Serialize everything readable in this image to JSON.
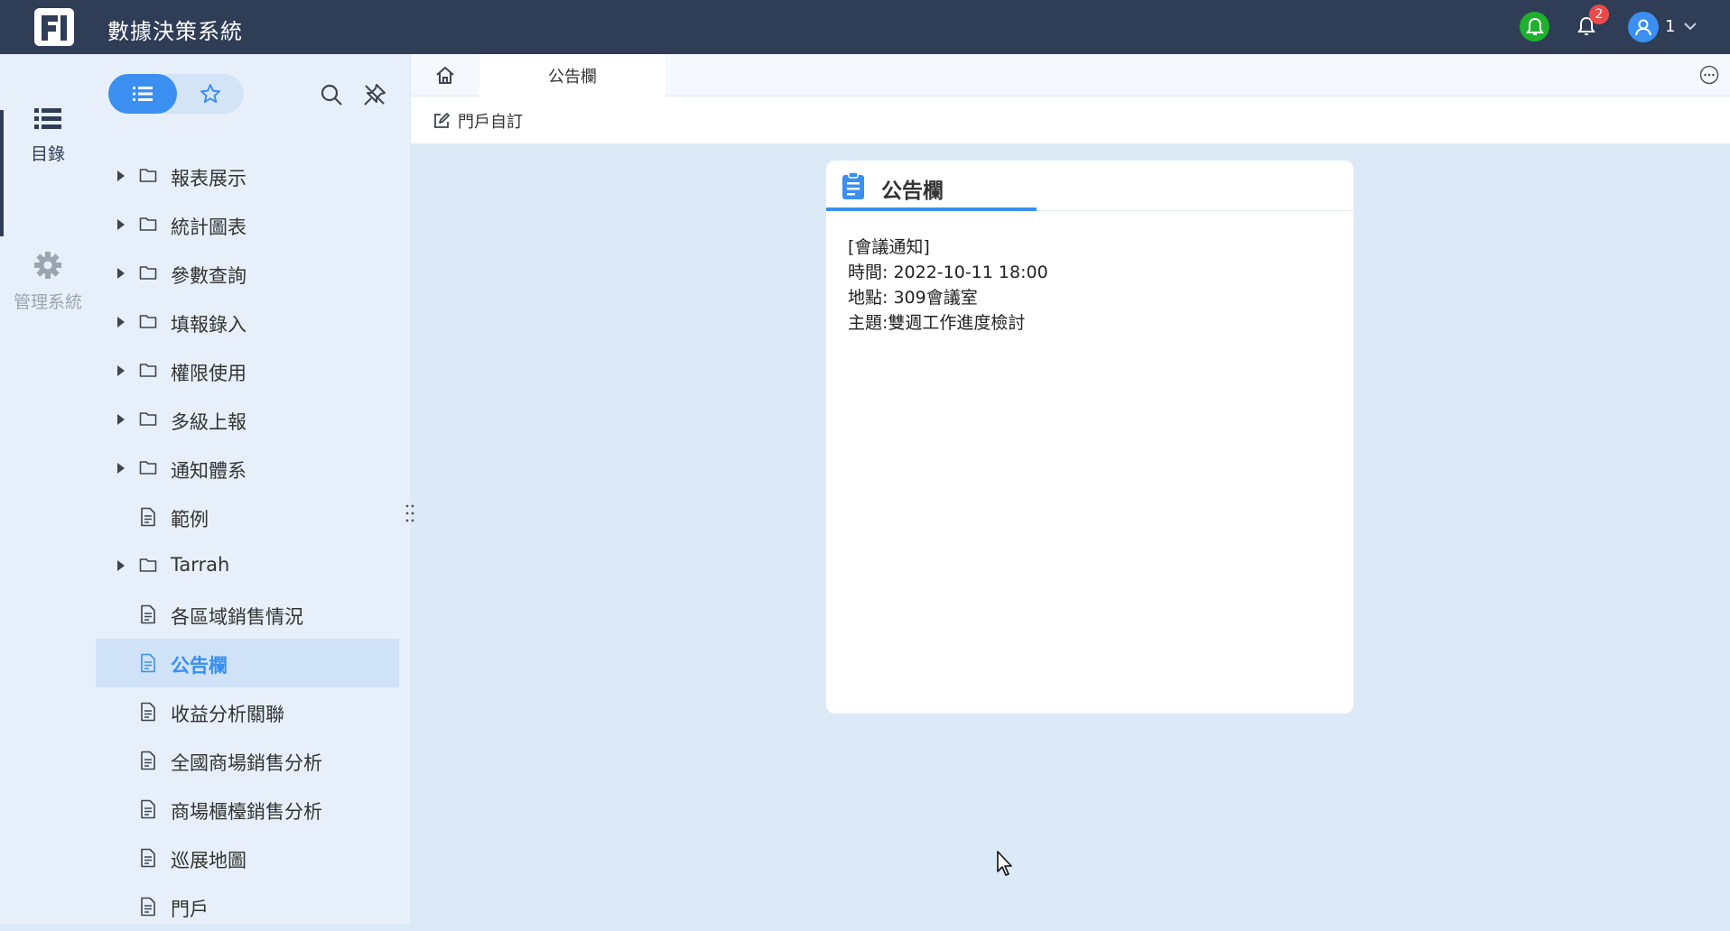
{
  "header": {
    "app_title": "數據決策系統",
    "notification_count": "2",
    "user_name": "1"
  },
  "rail": {
    "catalog_label": "目錄",
    "admin_label": "管理系統"
  },
  "tree": {
    "items": [
      {
        "label": "報表展示",
        "type": "folder"
      },
      {
        "label": "統計圖表",
        "type": "folder"
      },
      {
        "label": "參數查詢",
        "type": "folder"
      },
      {
        "label": "填報錄入",
        "type": "folder"
      },
      {
        "label": "權限使用",
        "type": "folder"
      },
      {
        "label": "多級上報",
        "type": "folder"
      },
      {
        "label": "通知體系",
        "type": "folder"
      },
      {
        "label": "範例",
        "type": "file"
      },
      {
        "label": "Tarrah",
        "type": "folder"
      },
      {
        "label": "各區域銷售情況",
        "type": "file"
      },
      {
        "label": "公告欄",
        "type": "file",
        "selected": true
      },
      {
        "label": "收益分析關聯",
        "type": "file"
      },
      {
        "label": "全國商場銷售分析",
        "type": "file"
      },
      {
        "label": "商場櫃檯銷售分析",
        "type": "file"
      },
      {
        "label": "巡展地圖",
        "type": "file"
      },
      {
        "label": "門戶",
        "type": "file"
      }
    ]
  },
  "tabs": {
    "active_label": "公告欄"
  },
  "toolbar": {
    "portal_custom_label": "門戶自訂"
  },
  "card": {
    "title": "公告欄",
    "lines": [
      "[會議通知]",
      "時間: 2022-10-11 18:00",
      "地點: 309會議室",
      "主題:雙週工作進度檢討"
    ]
  },
  "colors": {
    "header_bg": "#2f3d57",
    "accent": "#3a8ff0",
    "content_bg": "#dceaf8",
    "sidebar_bg": "#e7f0fa",
    "badge": "#e94b4b",
    "bell_green": "#1fb02e"
  }
}
